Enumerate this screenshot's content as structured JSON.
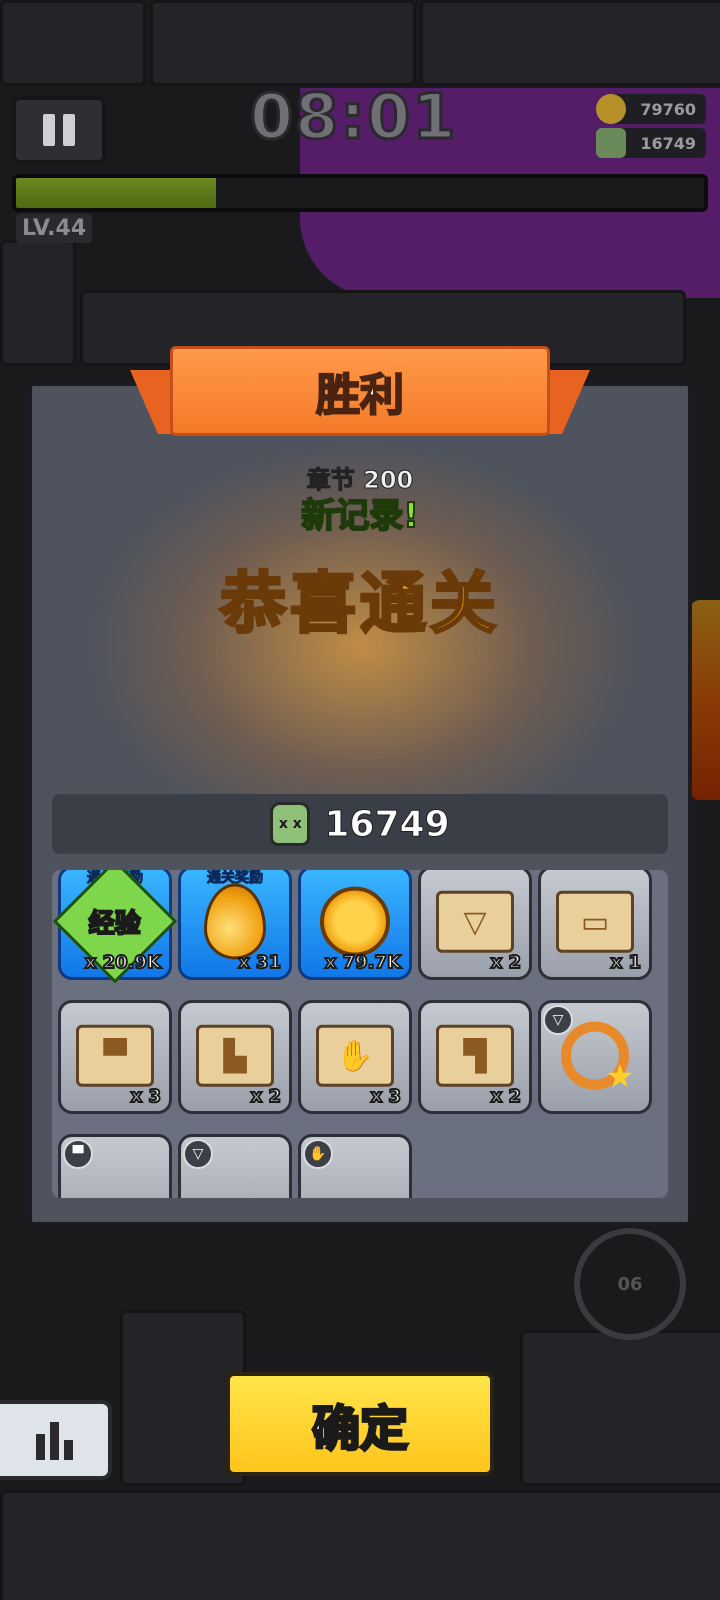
{
  "hud": {
    "timer": "08:01",
    "gold": "79760",
    "kills": "16749",
    "level": "LV.44",
    "xp_progress": 0.29
  },
  "dialog": {
    "title": "胜利",
    "chapter": "章节 200",
    "new_record": "新记录!",
    "congrats": "恭喜通关",
    "kill_count": "16749",
    "skull_icon_text": "x x",
    "rewards": [
      {
        "tag": "通关奖励",
        "icon": "exp-badge",
        "icon_text": "经验",
        "qty": "x 20.9K",
        "style": "blue"
      },
      {
        "tag": "通关奖励",
        "icon": "gem-drop-icon",
        "qty": "x 31",
        "style": "blue"
      },
      {
        "tag": "",
        "icon": "gold-coin-icon",
        "qty": "x 79.7K",
        "style": "blue"
      },
      {
        "tag": "",
        "icon": "necklace-scroll-icon",
        "qty": "x 2",
        "style": "gray"
      },
      {
        "tag": "",
        "icon": "belt-scroll-icon",
        "qty": "x 1",
        "style": "gray"
      },
      {
        "tag": "",
        "icon": "armor-scroll-icon",
        "qty": "x 3",
        "style": "gray"
      },
      {
        "tag": "",
        "icon": "boots-scroll-icon",
        "qty": "x 2",
        "style": "gray"
      },
      {
        "tag": "",
        "icon": "glove-scroll-icon",
        "qty": "x 3",
        "style": "gray"
      },
      {
        "tag": "",
        "icon": "gun-scroll-icon",
        "qty": "x 2",
        "style": "gray"
      },
      {
        "tag": "",
        "icon": "star-ring-icon",
        "qty": "",
        "style": "gray"
      }
    ]
  },
  "confirm_label": "确定",
  "skill_label": "06",
  "colors": {
    "banner": "#f47a28",
    "confirm": "#ffd22a",
    "new_record": "#8de23a",
    "congrats": "#ffb21e",
    "reward_blue": "#1e8cf0"
  }
}
